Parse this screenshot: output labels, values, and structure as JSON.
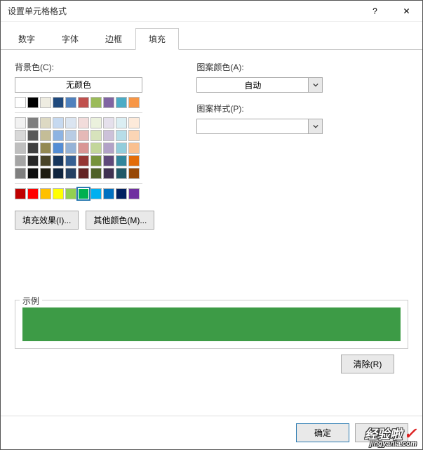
{
  "window": {
    "title": "设置单元格格式"
  },
  "tabs": {
    "num": "数字",
    "font": "字体",
    "border": "边框",
    "fill": "填充",
    "active": "fill"
  },
  "left": {
    "bgcolor_label": "背景色(C):",
    "nocolor": "无颜色",
    "fill_effects": "填充效果(I)...",
    "more_colors": "其他颜色(M)..."
  },
  "right": {
    "pattern_color_label": "图案颜色(A):",
    "pattern_color_value": "自动",
    "pattern_style_label": "图案样式(P):",
    "pattern_style_value": ""
  },
  "palette": {
    "row1": [
      "#ffffff",
      "#000000",
      "#eeece1",
      "#1f497d",
      "#4f81bd",
      "#c0504d",
      "#9bbb59",
      "#8064a2",
      "#4bacc6",
      "#f79646"
    ],
    "grid": [
      [
        "#f2f2f2",
        "#7f7f7f",
        "#ddd9c3",
        "#c6d9f0",
        "#dbe5f1",
        "#f2dcdb",
        "#ebf1dd",
        "#e5e0ec",
        "#dbeef3",
        "#fdeada"
      ],
      [
        "#d8d8d8",
        "#595959",
        "#c4bd97",
        "#8db3e2",
        "#b8cce4",
        "#e5b9b7",
        "#d7e3bc",
        "#ccc1d9",
        "#b7dde8",
        "#fbd5b5"
      ],
      [
        "#bfbfbf",
        "#3f3f3f",
        "#938953",
        "#548dd4",
        "#95b3d7",
        "#d99694",
        "#c3d69b",
        "#b2a2c7",
        "#92cddc",
        "#fac08f"
      ],
      [
        "#a5a5a5",
        "#262626",
        "#494429",
        "#17365d",
        "#366092",
        "#953734",
        "#76923c",
        "#5f497a",
        "#31859b",
        "#e36c09"
      ],
      [
        "#7f7f7f",
        "#0c0c0c",
        "#1d1b10",
        "#0f243e",
        "#244061",
        "#632423",
        "#4f6128",
        "#3f3151",
        "#205867",
        "#974806"
      ]
    ],
    "standard": [
      "#c00000",
      "#ff0000",
      "#ffc000",
      "#ffff00",
      "#92d050",
      "#00b050",
      "#00b0f0",
      "#0070c0",
      "#002060",
      "#7030a0"
    ],
    "selected": "#00b050"
  },
  "sample": {
    "label": "示例",
    "color": "#3d9b46"
  },
  "buttons": {
    "clear": "清除(R)",
    "ok": "确定",
    "cancel": "取消"
  },
  "watermark": {
    "main": "经验啦",
    "sub": "jingyanla.com"
  }
}
